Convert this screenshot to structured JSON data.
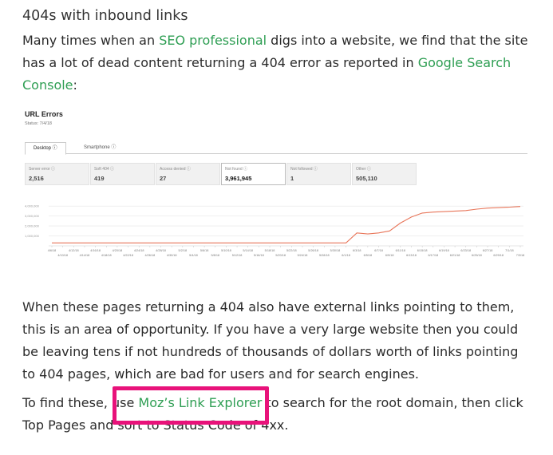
{
  "article": {
    "heading": "404s with inbound links",
    "p1": {
      "t1": "Many times when an ",
      "link1": "SEO professional",
      "t2": " digs into a website, we find that the site has a lot of dead content returning a 404 error as reported in ",
      "link2": "Google Search Console",
      "t3": ":"
    },
    "p2": "When these pages returning a 404 also have external links pointing to them, this is an area of opportunity. If you have a very large website then you could be leaving tens if not hundreds of thousands of dollars worth of links pointing to 404 pages, which are bad for users and for search engines.",
    "p3": {
      "t1": "To find these, use ",
      "link": "Moz’s Link Explorer",
      "t2": " to search for the root domain, then click Top Pages and sort to Status Code of 4xx."
    },
    "link_color": "#2e9e53",
    "highlight_color": "#e8127a"
  },
  "gsc": {
    "title": "URL Errors",
    "status": "Status: 7/4/18",
    "tabs": [
      {
        "label": "Desktop ⓘ",
        "active": true
      },
      {
        "label": "Smartphone ⓘ",
        "active": false
      }
    ],
    "metrics": [
      {
        "label": "Server error ⓘ",
        "value": "2,516"
      },
      {
        "label": "Soft 404 ⓘ",
        "value": "419"
      },
      {
        "label": "Access denied ⓘ",
        "value": "27"
      },
      {
        "label": "Not found ⓘ",
        "value": "3,961,945",
        "active": true
      },
      {
        "label": "Not followed ⓘ",
        "value": "1"
      },
      {
        "label": "Other ⓘ",
        "value": "505,110"
      }
    ]
  },
  "chart_data": {
    "type": "line",
    "title": "",
    "xlabel": "",
    "ylabel": "",
    "y_ticks": [
      "4,000,000",
      "3,000,000",
      "2,000,000",
      "1,000,000"
    ],
    "ylim": [
      0,
      4500000
    ],
    "x_tick_labels": [
      "4/6/18",
      "4/10/18",
      "4/12/18",
      "4/14/18",
      "4/16/18",
      "4/18/18",
      "4/20/18",
      "4/22/18",
      "4/24/18",
      "4/26/18",
      "4/28/18",
      "4/30/18",
      "5/2/18",
      "5/4/18",
      "5/6/18",
      "5/8/18",
      "5/10/18",
      "5/12/18",
      "5/14/18",
      "5/16/18",
      "5/18/18",
      "5/20/18",
      "5/22/18",
      "5/24/18",
      "5/26/18",
      "5/28/18",
      "5/30/18",
      "6/1/18",
      "6/3/18",
      "6/5/18",
      "6/7/18",
      "6/9/18",
      "6/11/18",
      "6/13/18",
      "6/15/18",
      "6/17/18",
      "6/19/18",
      "6/21/18",
      "6/23/18",
      "6/25/18",
      "6/27/18",
      "6/29/18",
      "7/1/18",
      "7/3/18"
    ],
    "series": [
      {
        "color": "#e8765a",
        "values": [
          300000,
          300000,
          300000,
          300000,
          300000,
          300000,
          300000,
          300000,
          300000,
          300000,
          300000,
          300000,
          300000,
          300000,
          300000,
          300000,
          300000,
          300000,
          300000,
          300000,
          300000,
          300000,
          300000,
          300000,
          300000,
          300000,
          300000,
          300000,
          1300000,
          1200000,
          1300000,
          1500000,
          2300000,
          2900000,
          3300000,
          3400000,
          3450000,
          3500000,
          3550000,
          3700000,
          3800000,
          3850000,
          3900000,
          3960000
        ]
      }
    ],
    "grid": true
  }
}
